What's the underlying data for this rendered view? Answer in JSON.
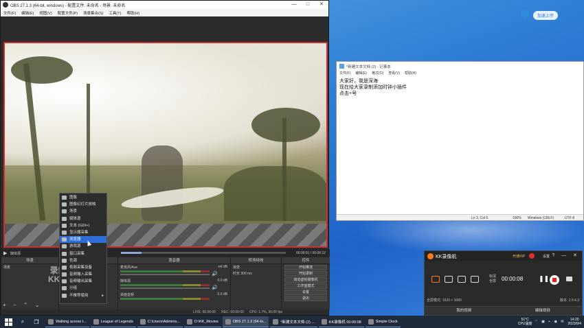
{
  "desktop": {
    "cloud_widget_label": "加速上传"
  },
  "obs": {
    "title": "OBS 27.1.3 (64-bit, windows) - 配置文件: 未命名 - 场景: 未命名",
    "menu": [
      "文件(F)",
      "编辑(E)",
      "视图(V)",
      "配置文件(P)",
      "场景集合(S)",
      "工具(T)",
      "帮助(H)"
    ],
    "window_buttons": [
      "—",
      "□",
      "✕"
    ],
    "transport": {
      "play_label": "▶",
      "scene_label": "媒体源",
      "time": "00:00:01 / 00:00:12"
    },
    "docks": {
      "scenes_header": "场景",
      "scenes_items": [
        "场景"
      ],
      "sources_header": "来源",
      "mixer_header": "混音器",
      "mixer_rows": [
        {
          "name": "麦克风/Aux",
          "db": "-inf dB"
        },
        {
          "name": "媒体源",
          "db": "0.0 dB"
        },
        {
          "name": "桌面音频",
          "db": "0.0 dB"
        }
      ],
      "transitions_header": "转场特效",
      "transition_value": "渐变",
      "duration_label": "时长",
      "duration_value": "300 ms",
      "controls_header": "控件",
      "controls": [
        "开始推流",
        "开始录制",
        "启动虚拟摄像机",
        "工作室模式",
        "设置",
        "退出"
      ]
    },
    "statusbar": {
      "live": "LIVE: 00:00:00",
      "rec": "REC: 00:00:00",
      "cpu": "CPU: 1.7%, 30.00 fps"
    }
  },
  "context_menu": {
    "items": [
      {
        "label": "图像",
        "selected": false
      },
      {
        "label": "图像幻灯片放映",
        "selected": false
      },
      {
        "label": "场景",
        "selected": false
      },
      {
        "label": "媒体源",
        "selected": false
      },
      {
        "label": "文本 (GDI+)",
        "selected": false
      },
      {
        "label": "显示器采集",
        "selected": false
      },
      {
        "label": "浏览器",
        "selected": true
      },
      {
        "label": "游戏源",
        "selected": false
      },
      {
        "label": "窗口采集",
        "selected": false
      },
      {
        "label": "色源",
        "selected": false
      },
      {
        "label": "视频采集设备",
        "selected": false
      },
      {
        "label": "音频输入采集",
        "selected": false
      },
      {
        "label": "音频输出采集",
        "selected": false
      },
      {
        "label": "分组",
        "selected": false
      },
      {
        "label": "不推荐使用",
        "selected": false,
        "submenu": true
      }
    ]
  },
  "watermark": {
    "line1": "录制工具",
    "line2": "KK录像机"
  },
  "notepad": {
    "title": "*新建文本文档 (2) - 记事本",
    "menu": [
      "文件(F)",
      "编辑(E)",
      "格式(O)",
      "查看(V)",
      "帮助(H)"
    ],
    "lines": [
      "大家好，我是深海",
      "现在给大家录制添加时钟小插件",
      "点击+号"
    ],
    "status": {
      "position": "Ln 3, Col 5",
      "zoom": "100%",
      "eol": "Windows (CRLF)",
      "encoding": "UTF-8"
    }
  },
  "kk": {
    "name": "KK录像机",
    "vip": "开通VIP",
    "settings": "设置",
    "window_buttons": "? — ✕",
    "mode_label": "标清",
    "mode_sub": "全屏",
    "timer": "00:00:08",
    "fullscreen_mode": "全屏模式: 1920 × 1080",
    "version": "版本: 2.9.4.3",
    "bottom_tabs": [
      "我的视频",
      "编辑视频"
    ]
  },
  "taskbar": {
    "tasks": [
      {
        "label": "Walking across t...",
        "active": false
      },
      {
        "label": "League of Legends",
        "active": false
      },
      {
        "label": "C:\\Users\\Adminis...",
        "active": false
      },
      {
        "label": "D:\\KK_Movies",
        "active": false
      },
      {
        "label": "OBS 27.1.3 (64-bi...",
        "active": true
      },
      {
        "label": "*新建文本文档 (2) ...",
        "active": false
      },
      {
        "label": "KK录像机 00:00:08",
        "active": false
      },
      {
        "label": "Simple Clock",
        "active": false
      }
    ],
    "cpu_temp": "51°C",
    "cpu_label": "CPU温度",
    "time": "14:20",
    "date": "2023/9/4"
  },
  "colors": {
    "accent_selection": "#2f6ed8",
    "preview_border": "#d03030",
    "kk_brand": "#ff7a1a"
  }
}
